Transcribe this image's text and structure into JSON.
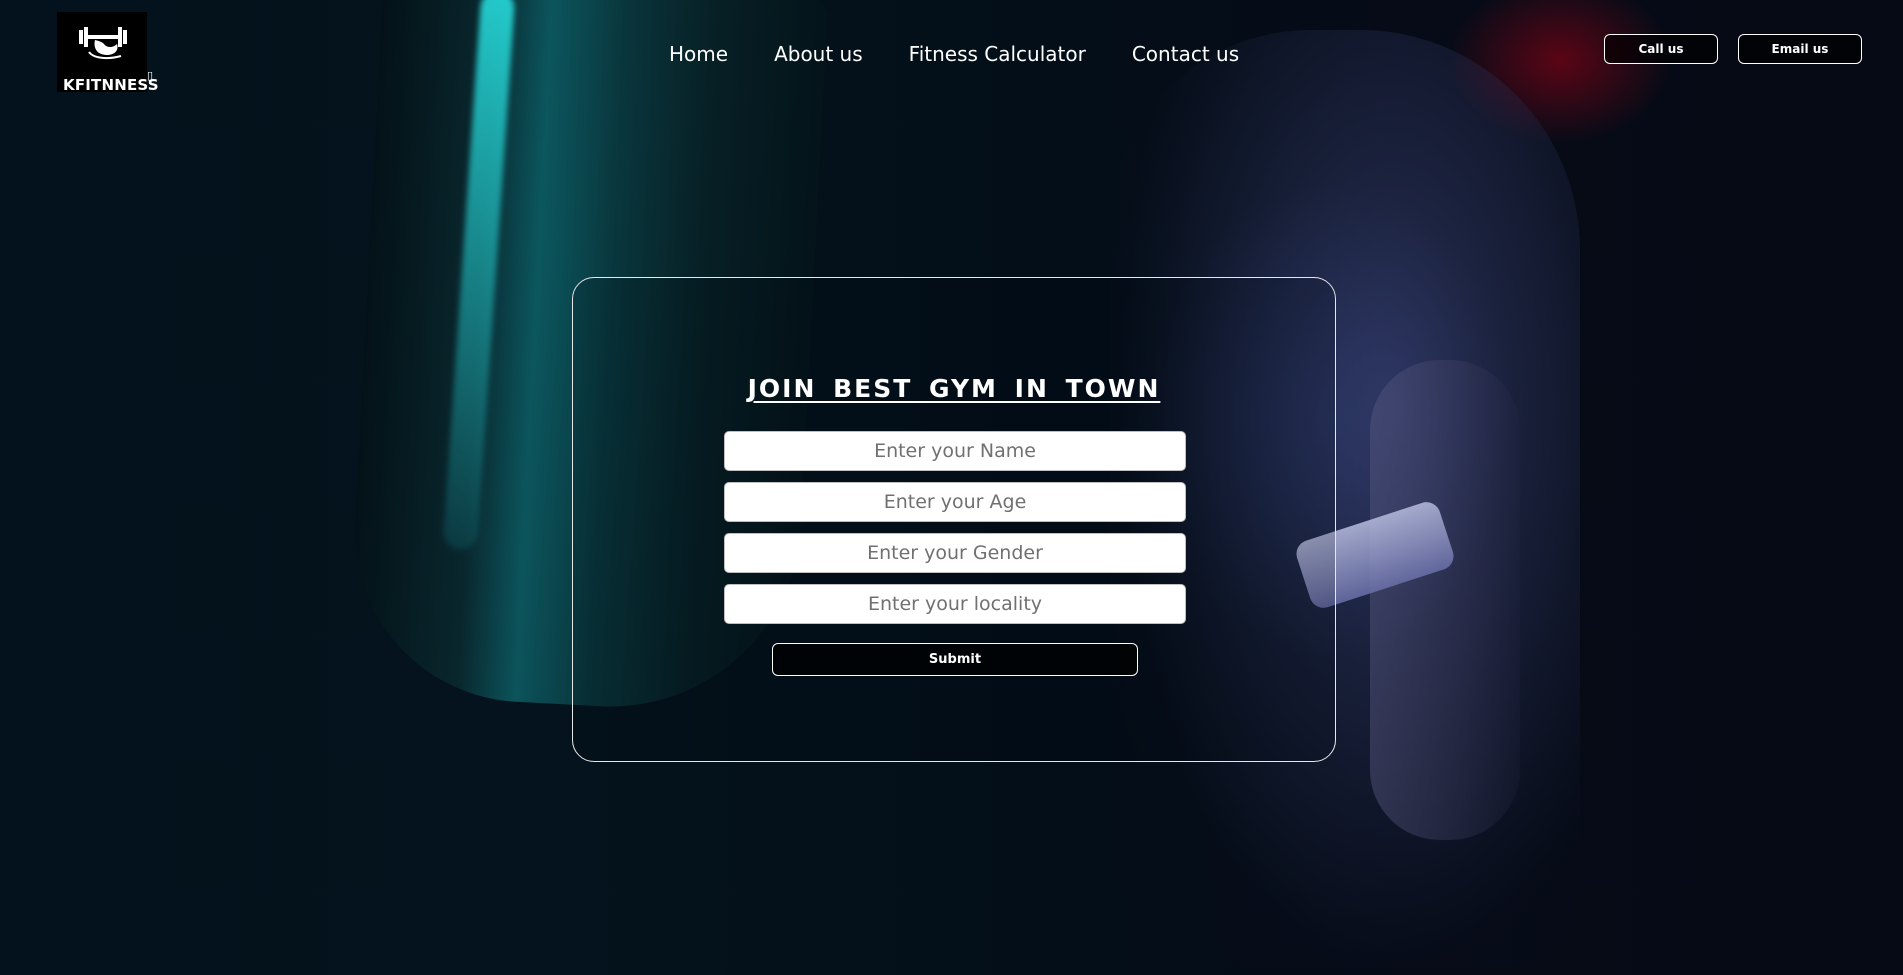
{
  "header": {
    "logo_text": "KFITNNESS",
    "logo_glyph": "▯",
    "nav": [
      {
        "label": "Home"
      },
      {
        "label": "About us"
      },
      {
        "label": "Fitness Calculator"
      },
      {
        "label": "Contact us"
      }
    ],
    "call_label": "Call us",
    "email_label": "Email us"
  },
  "form": {
    "title": "JOIN BEST GYM IN TOWN",
    "fields": [
      {
        "placeholder": "Enter your Name",
        "value": ""
      },
      {
        "placeholder": "Enter your Age",
        "value": ""
      },
      {
        "placeholder": "Enter your Gender",
        "value": ""
      },
      {
        "placeholder": "Enter your locality",
        "value": ""
      }
    ],
    "submit_label": "Submit"
  },
  "colors": {
    "background": "#02090f",
    "accent_teal": "#1fd9d9",
    "accent_red": "#a00014",
    "text": "#ffffff"
  },
  "icons": {
    "logo": "dumbbell-arm-icon"
  }
}
